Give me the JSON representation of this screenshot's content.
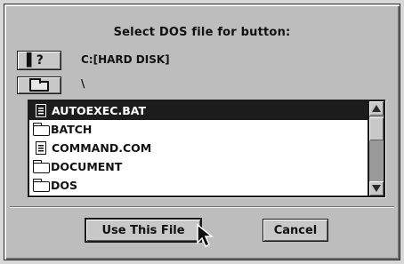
{
  "dialog": {
    "title": "Select DOS file for button:",
    "drive_button_glyph": "▌?",
    "drive_label": "C:[HARD DISK]",
    "path_label": "\\"
  },
  "file_list": {
    "items": [
      {
        "name": "AUTOEXEC.BAT",
        "type": "file",
        "selected": true
      },
      {
        "name": "BATCH",
        "type": "folder",
        "selected": false
      },
      {
        "name": "COMMAND.COM",
        "type": "file",
        "selected": false
      },
      {
        "name": "DOCUMENT",
        "type": "folder",
        "selected": false
      },
      {
        "name": "DOS",
        "type": "folder",
        "selected": false
      }
    ]
  },
  "buttons": {
    "use_label": "Use This File",
    "cancel_label": "Cancel"
  },
  "icons": {
    "drive": "drive-help-icon",
    "folder_up": "folder-icon",
    "file": "document-icon",
    "folder": "folder-icon",
    "cursor": "arrow-pointer-icon"
  }
}
